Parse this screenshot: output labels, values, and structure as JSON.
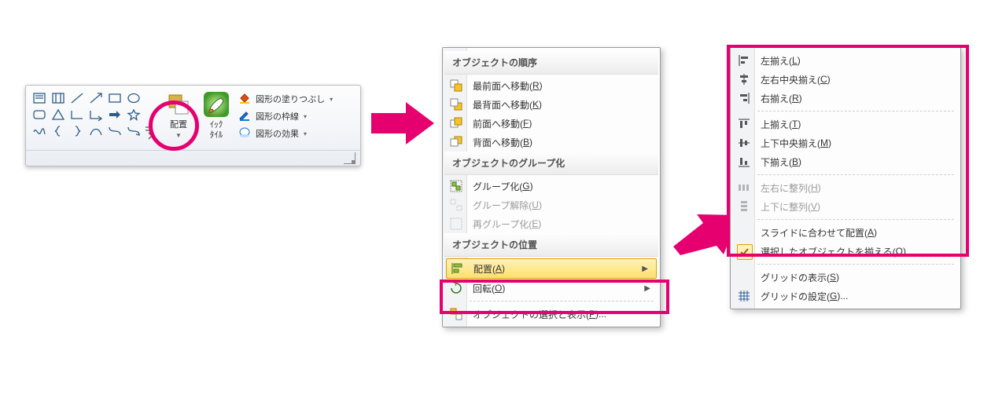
{
  "ribbon": {
    "big_buttons": {
      "arrange_label": "配置",
      "quick_label": "ｲｯｸ",
      "style_label": "ﾀｲﾙ"
    },
    "options": {
      "fill_label": "図形の塗りつぶし",
      "outline_label": "図形の枠線",
      "effects_label": "図形の効果"
    }
  },
  "menu1": {
    "section_order": "オブジェクトの順序",
    "items_order": [
      {
        "label_pre": "最前面へ移動(",
        "kbd": "R",
        "label_post": ")"
      },
      {
        "label_pre": "最背面へ移動(",
        "kbd": "K",
        "label_post": ")"
      },
      {
        "label_pre": "前面へ移動(",
        "kbd": "F",
        "label_post": ")"
      },
      {
        "label_pre": "背面へ移動(",
        "kbd": "B",
        "label_post": ")"
      }
    ],
    "section_group": "オブジェクトのグループ化",
    "items_group": [
      {
        "label_pre": "グループ化(",
        "kbd": "G",
        "label_post": ")",
        "disabled": false
      },
      {
        "label_pre": "グループ解除(",
        "kbd": "U",
        "label_post": ")",
        "disabled": true
      },
      {
        "label_pre": "再グループ化(",
        "kbd": "E",
        "label_post": ")",
        "disabled": true
      }
    ],
    "section_pos": "オブジェクトの位置",
    "items_pos": [
      {
        "label_pre": "配置(",
        "kbd": "A",
        "label_post": ")",
        "sub": true,
        "hl": true
      },
      {
        "label_pre": "回転(",
        "kbd": "O",
        "label_post": ")",
        "sub": true
      }
    ],
    "select_item": {
      "label_pre": "オブジェクトの選択と表示(",
      "kbd": "P",
      "label_post": ")..."
    }
  },
  "menu2": {
    "items_align": [
      {
        "label_pre": "左揃え(",
        "kbd": "L",
        "label_post": ")"
      },
      {
        "label_pre": "左右中央揃え(",
        "kbd": "C",
        "label_post": ")"
      },
      {
        "label_pre": "右揃え(",
        "kbd": "R",
        "label_post": ")"
      }
    ],
    "items_valign": [
      {
        "label_pre": "上揃え(",
        "kbd": "T",
        "label_post": ")"
      },
      {
        "label_pre": "上下中央揃え(",
        "kbd": "M",
        "label_post": ")"
      },
      {
        "label_pre": "下揃え(",
        "kbd": "B",
        "label_post": ")"
      }
    ],
    "items_dist": [
      {
        "label_pre": "左右に整列(",
        "kbd": "H",
        "label_post": ")",
        "disabled": true
      },
      {
        "label_pre": "上下に整列(",
        "kbd": "V",
        "label_post": ")",
        "disabled": true
      }
    ],
    "items_opt": [
      {
        "label_pre": "スライドに合わせて配置(",
        "kbd": "A",
        "label_post": ")"
      },
      {
        "label_pre": "選択したオブジェクトを揃える(",
        "kbd": "O",
        "label_post": ")",
        "check": true
      }
    ],
    "items_grid": [
      {
        "label_pre": "グリッドの表示(",
        "kbd": "S",
        "label_post": ")"
      },
      {
        "label_pre": "グリッドの設定(",
        "kbd": "G",
        "label_post": ")..."
      }
    ]
  }
}
